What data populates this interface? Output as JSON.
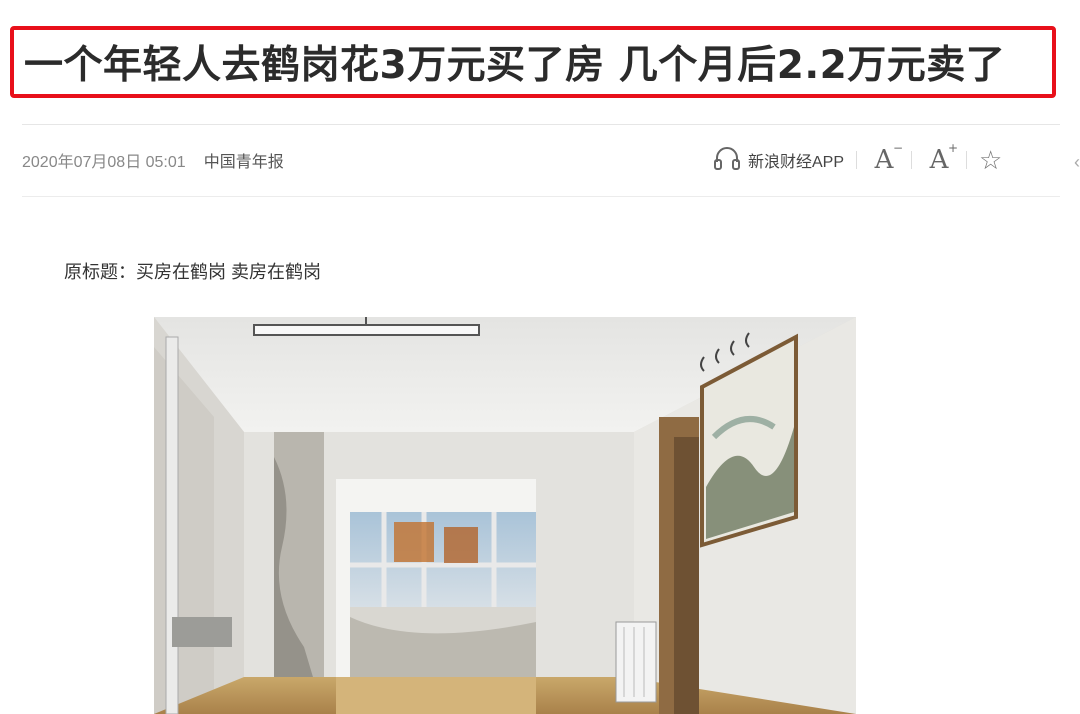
{
  "article": {
    "title": "一个年轻人去鹤岗花3万元买了房 几个月后2.2万元卖了",
    "date": "2020年07月08日 05:01",
    "source": "中国青年报",
    "original_title": "原标题：买房在鹤岗 卖房在鹤岗"
  },
  "toolbar": {
    "app_label": "新浪财经APP",
    "items": [
      {
        "icon": "headphones-icon"
      },
      {
        "icon": "font-decrease-icon"
      },
      {
        "icon": "font-increase-icon"
      },
      {
        "icon": "star-icon"
      }
    ]
  },
  "image": {
    "subject": "empty apartment interior"
  }
}
